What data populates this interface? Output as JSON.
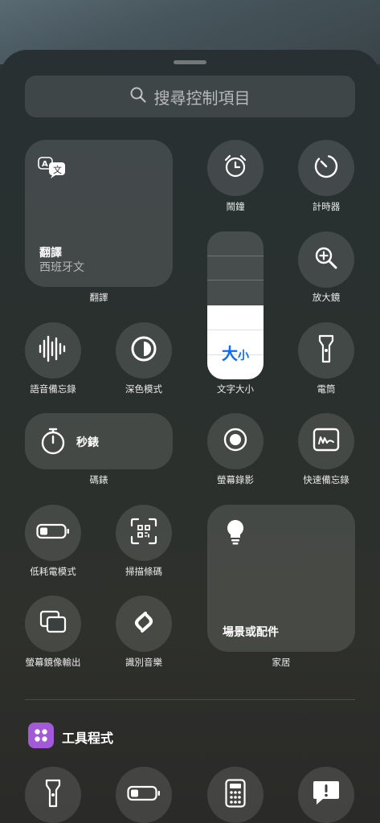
{
  "search": {
    "placeholder": "搜尋控制項目"
  },
  "translate": {
    "title": "翻譯",
    "subtitle": "西班牙文",
    "label": "翻譯"
  },
  "controls": {
    "alarm": "鬧鐘",
    "timer": "計時器",
    "magnifier": "放大鏡",
    "text_size": "文字大小",
    "text_size_glyph_big": "大",
    "text_size_glyph_small": "小",
    "text_size_level": 0.5,
    "voice_memos": "語音備忘錄",
    "dark_mode": "深色模式",
    "flashlight": "電筒",
    "stopwatch_tile": "秒錶",
    "stopwatch_label": "碼錶",
    "screen_recording": "螢幕錄影",
    "quick_note": "快速備忘錄",
    "low_power": "低耗電模式",
    "scan_code": "掃描條碼",
    "home_tile": "場景或配件",
    "home_label": "家居",
    "screen_mirroring": "螢幕鏡像輸出",
    "shazam": "識別音樂"
  },
  "section": {
    "tools_title": "工具程式"
  },
  "colors": {
    "accent_blue": "#0a6cff",
    "tools_purple": "#a25ad8"
  }
}
